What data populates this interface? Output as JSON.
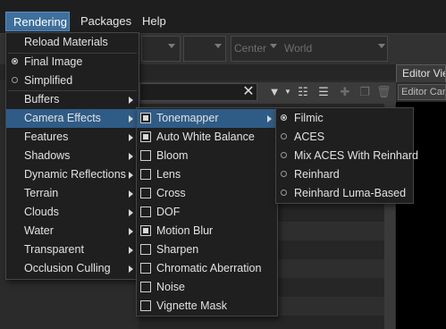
{
  "menubar": {
    "items": [
      {
        "label": "Rendering",
        "active": true
      },
      {
        "label": "Packages",
        "active": false
      },
      {
        "label": "Help",
        "active": false
      }
    ]
  },
  "toolbar": {
    "pivot_select": "Center",
    "space_select": "World"
  },
  "editor": {
    "tab_label": "Editor View",
    "camera_select": "Editor Camera"
  },
  "rendering_menu": {
    "items": [
      {
        "label": "Reload Materials",
        "kind": "action"
      },
      {
        "label": "Final Image",
        "kind": "radio",
        "checked": true
      },
      {
        "label": "Simplified",
        "kind": "radio",
        "checked": false
      },
      {
        "label": "Buffers",
        "kind": "submenu"
      },
      {
        "label": "Camera Effects",
        "kind": "submenu",
        "highlighted": true
      },
      {
        "label": "Features",
        "kind": "submenu"
      },
      {
        "label": "Shadows",
        "kind": "submenu"
      },
      {
        "label": "Dynamic Reflections",
        "kind": "submenu"
      },
      {
        "label": "Terrain",
        "kind": "submenu"
      },
      {
        "label": "Clouds",
        "kind": "submenu"
      },
      {
        "label": "Water",
        "kind": "submenu"
      },
      {
        "label": "Transparent",
        "kind": "submenu"
      },
      {
        "label": "Occlusion Culling",
        "kind": "submenu"
      }
    ]
  },
  "camera_effects_menu": {
    "items": [
      {
        "label": "Tonemapper",
        "checked": true,
        "submenu": true,
        "highlighted": true
      },
      {
        "label": "Auto White Balance",
        "checked": true
      },
      {
        "label": "Bloom",
        "checked": false
      },
      {
        "label": "Lens",
        "checked": false
      },
      {
        "label": "Cross",
        "checked": false
      },
      {
        "label": "DOF",
        "checked": false
      },
      {
        "label": "Motion Blur",
        "checked": true
      },
      {
        "label": "Sharpen",
        "checked": false
      },
      {
        "label": "Chromatic Aberration",
        "checked": false
      },
      {
        "label": "Noise",
        "checked": false
      },
      {
        "label": "Vignette Mask",
        "checked": false
      }
    ]
  },
  "tonemapper_menu": {
    "items": [
      {
        "label": "Filmic",
        "checked": true
      },
      {
        "label": "ACES",
        "checked": false
      },
      {
        "label": "Mix ACES With Reinhard",
        "checked": false
      },
      {
        "label": "Reinhard",
        "checked": false
      },
      {
        "label": "Reinhard Luma-Based",
        "checked": false
      }
    ]
  },
  "colors": {
    "menu_bg": "#1f1f1f",
    "highlight": "#2f5c86",
    "active_menu": "#3f6f9c",
    "text": "#e2e2e2"
  }
}
